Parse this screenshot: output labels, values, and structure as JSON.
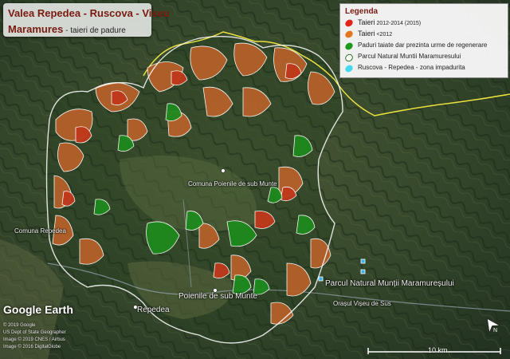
{
  "title": {
    "line1": "Valea Repedea - Ruscova - Viseu",
    "line2_main": "Maramures",
    "line2_sub": " - taieri de padure"
  },
  "legend": {
    "title": "Legenda",
    "items": [
      {
        "label_main": "Taieri",
        "label_sub": " 2012-2014 (2015)",
        "color": "#e0261b",
        "icon": "red-leaf-icon"
      },
      {
        "label_main": "Taieri",
        "label_sub": " <2012",
        "color": "#e3761f",
        "icon": "orange-leaf-icon"
      },
      {
        "label_main": "",
        "label_sub": "Paduri taiate dar prezinta urme de regenerare",
        "color": "#1d9a1d",
        "icon": "green-leaf-icon"
      },
      {
        "label_main": "",
        "label_sub": "Parcul Natural Muntii Maramuresului",
        "color": "#ffffff",
        "icon": "white-outline-icon"
      },
      {
        "label_main": "",
        "label_sub": "Ruscova - Repedea - zona impadurita",
        "color": "#45d9f0",
        "icon": "cyan-fill-icon"
      }
    ]
  },
  "map_labels": {
    "comuna_poienile": "Comuna Poienile de sub Munte",
    "comuna_repedea": "Comuna Repedea",
    "poienile": "Poienile de sub Munte",
    "repedea": "Repedea",
    "parc": "Parcul Natural Munții Maramureșului",
    "viseu": "Orașul Vișeu de Sus"
  },
  "logo": "Google Earth",
  "credits": [
    "© 2019 Google",
    "US Dept of State Geographer",
    "Image © 2019 CNES / Airbus",
    "Image © 2016 DigitalGlobe"
  ],
  "scale": {
    "label": "10 km"
  },
  "colors": {
    "recent_cut": "#c0391b",
    "old_cut": "#b5612a",
    "regen": "#1e8a1e",
    "park_boundary": "#ffffff",
    "border_line": "#e8e040",
    "background": "#2c3d24"
  }
}
